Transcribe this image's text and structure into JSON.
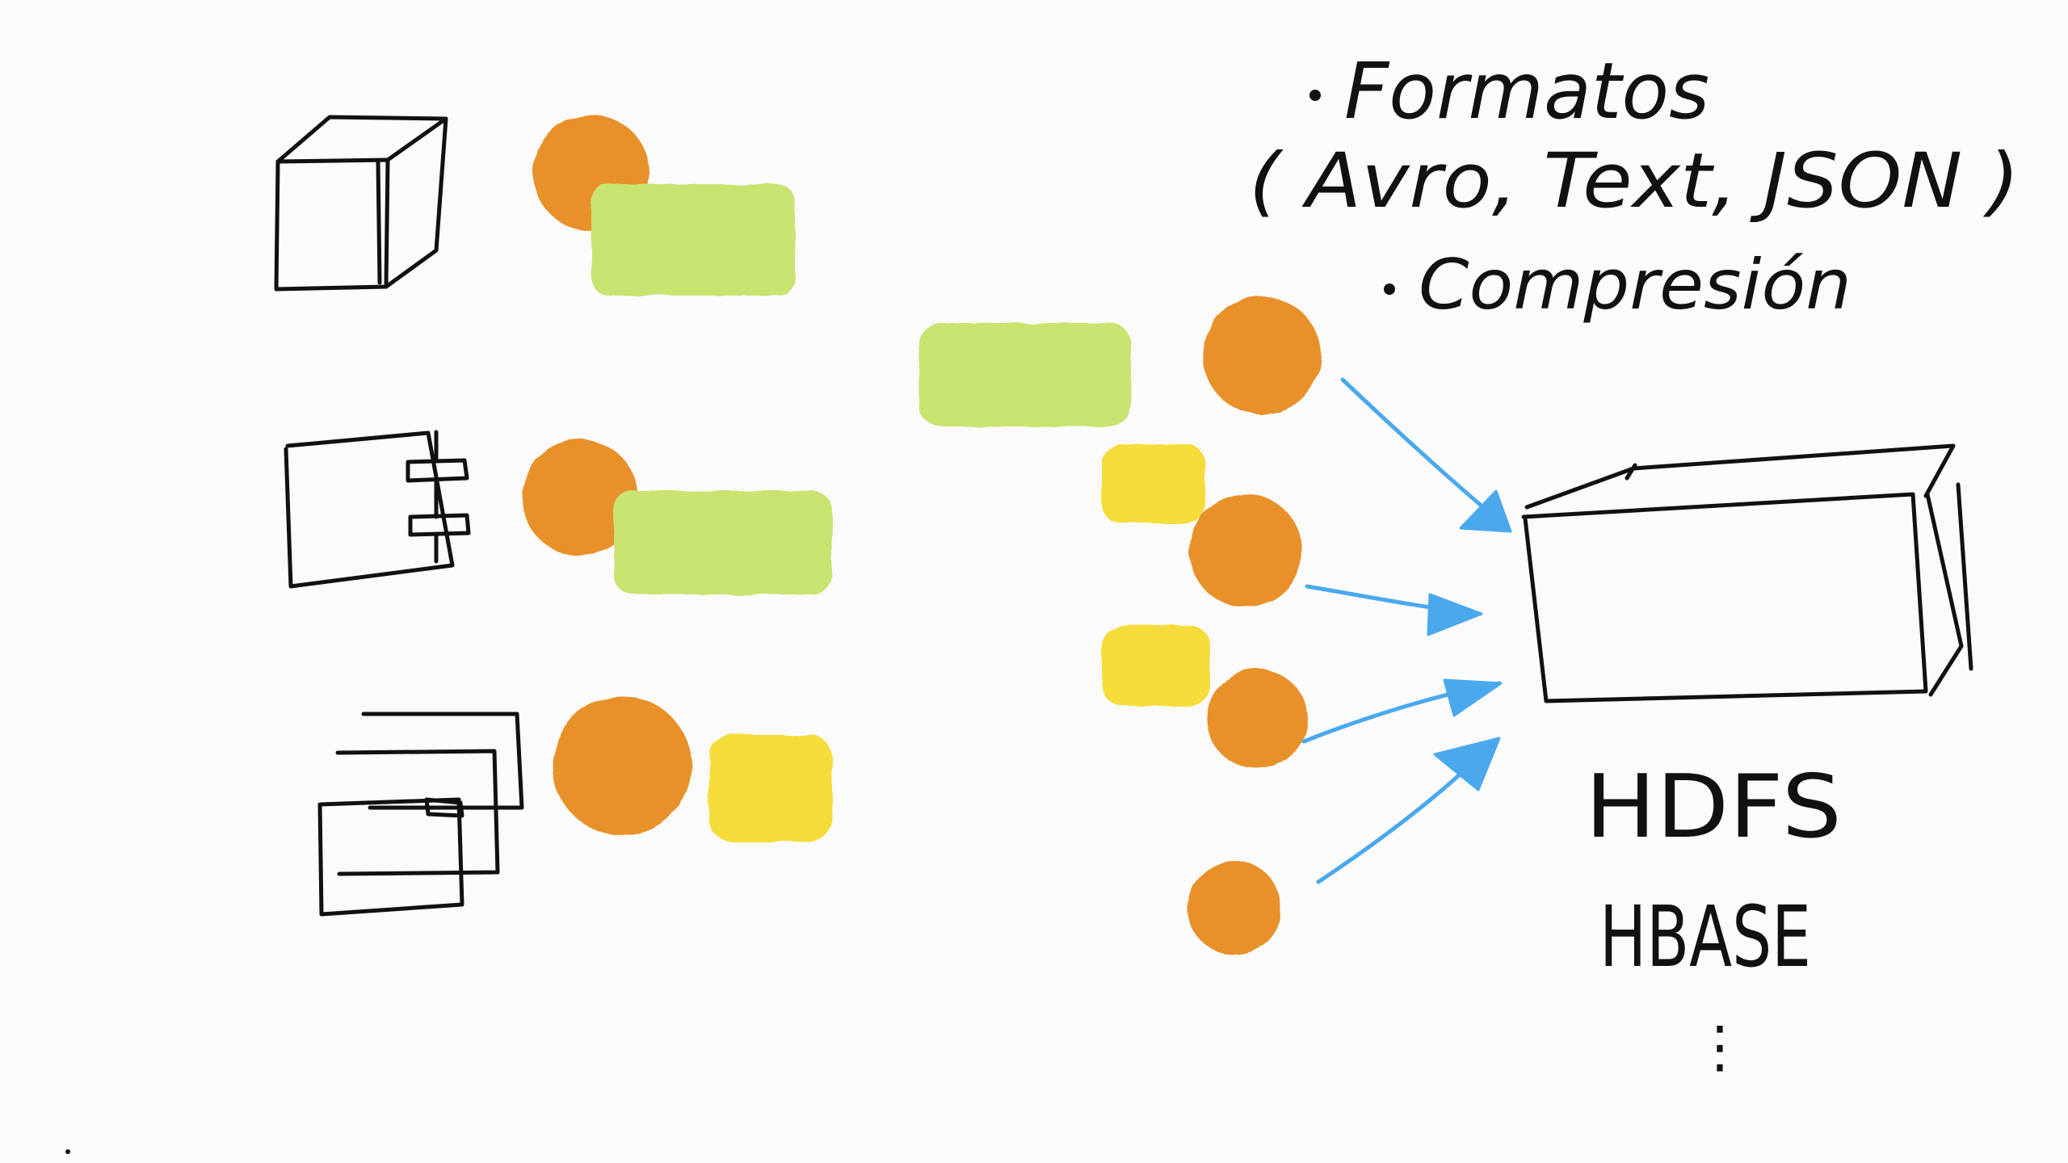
{
  "colors": {
    "background": "#fbfbfb",
    "ink": "#111111",
    "orange": "#e8912b",
    "green": "#c9e36f",
    "yellow": "#f6dc3a",
    "arrow_blue": "#4aa8ec"
  },
  "notes": {
    "bullet_1": "Formatos",
    "formats_line": "( Avro, Text, JSON )",
    "bullet_2": "Compresión"
  },
  "storage_targets": {
    "hdfs": "HDFS",
    "hbase": "HBASE",
    "ellipsis": "⋮"
  },
  "icons": {
    "source_1": "cube-icon",
    "source_2": "component-icon",
    "source_3": "stacked-documents-icon",
    "target": "storage-box-icon"
  }
}
